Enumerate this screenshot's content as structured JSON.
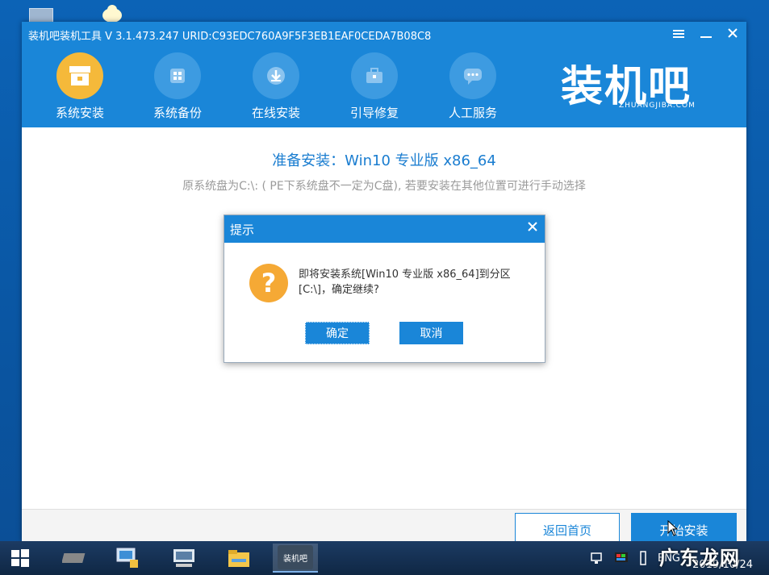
{
  "window": {
    "title": "装机吧装机工具 V 3.1.473.247 URID:C93EDC760A9F5F3EB1EAF0CEDA7B08C8",
    "menu_icon": "menu-icon",
    "minimize_icon": "minimize-icon",
    "close_icon": "close-icon"
  },
  "nav": {
    "items": [
      {
        "label": "系统安装",
        "icon": "system-install-icon",
        "active": true
      },
      {
        "label": "系统备份",
        "icon": "system-backup-icon",
        "active": false
      },
      {
        "label": "在线安装",
        "icon": "download-icon",
        "active": false
      },
      {
        "label": "引导修复",
        "icon": "toolbox-icon",
        "active": false
      },
      {
        "label": "人工服务",
        "icon": "chat-icon",
        "active": false
      }
    ]
  },
  "logo": {
    "text": "装机吧",
    "sub": "ZHUANGJIBA.COM"
  },
  "main": {
    "title": "准备安装：Win10 专业版 x86_64",
    "note": "原系统盘为C:\\: ( PE下系统盘不一定为C盘), 若要安装在其他位置可进行手动选择"
  },
  "footer": {
    "back_label": "返回首页",
    "start_label": "开始安装"
  },
  "dialog": {
    "title": "提示",
    "message": "即将安装系统[Win10 专业版 x86_64]到分区[C:\\]，确定继续?",
    "ok_label": "确定",
    "cancel_label": "取消"
  },
  "taskbar": {
    "lang": "ENG",
    "date": "2019/10/24",
    "app_label": "装机吧"
  },
  "watermark": "广东龙网",
  "colors": {
    "primary": "#1a86d8",
    "accent": "#f5b93a",
    "warn": "#f5a935"
  }
}
